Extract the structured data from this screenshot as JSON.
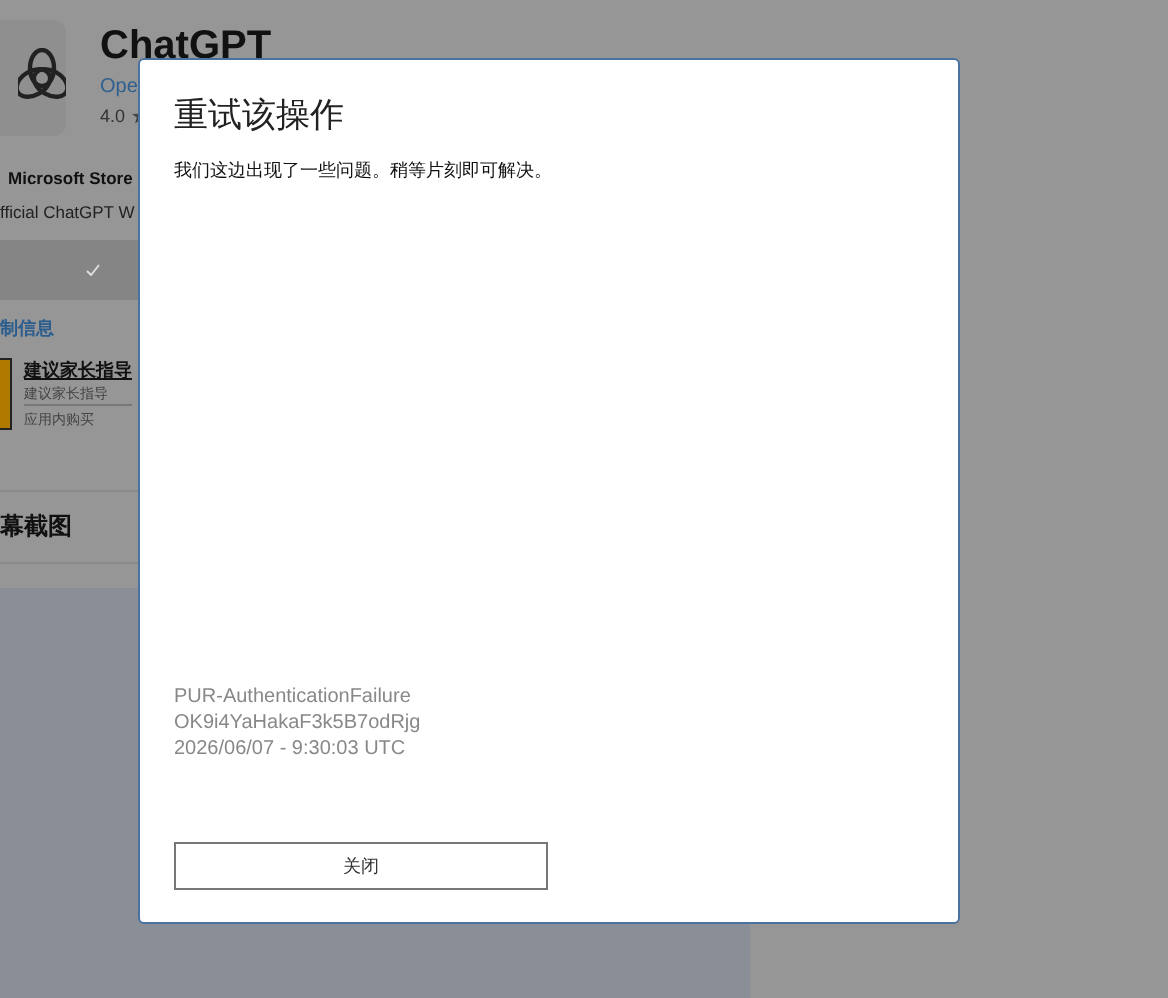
{
  "app": {
    "title": "ChatGPT",
    "publisher": "Ope",
    "rating": "4.0",
    "store_label": "Microsoft Store",
    "description": "fficial ChatGPT W",
    "section_link": "制信息",
    "age_rating": {
      "title": "建议家长指导",
      "subtitle": "建议家长指导",
      "note": "应用内购买"
    },
    "screenshots_heading": "幕截图"
  },
  "dialog": {
    "title": "重试该操作",
    "message": "我们这边出现了一些问题。稍等片刻即可解决。",
    "error_code": "PUR-AuthenticationFailure",
    "correlation_id": "OK9i4YaHakaF3k5B7odRjg",
    "timestamp": "2026/06/07 - 9:30:03 UTC",
    "button": "关闭"
  }
}
